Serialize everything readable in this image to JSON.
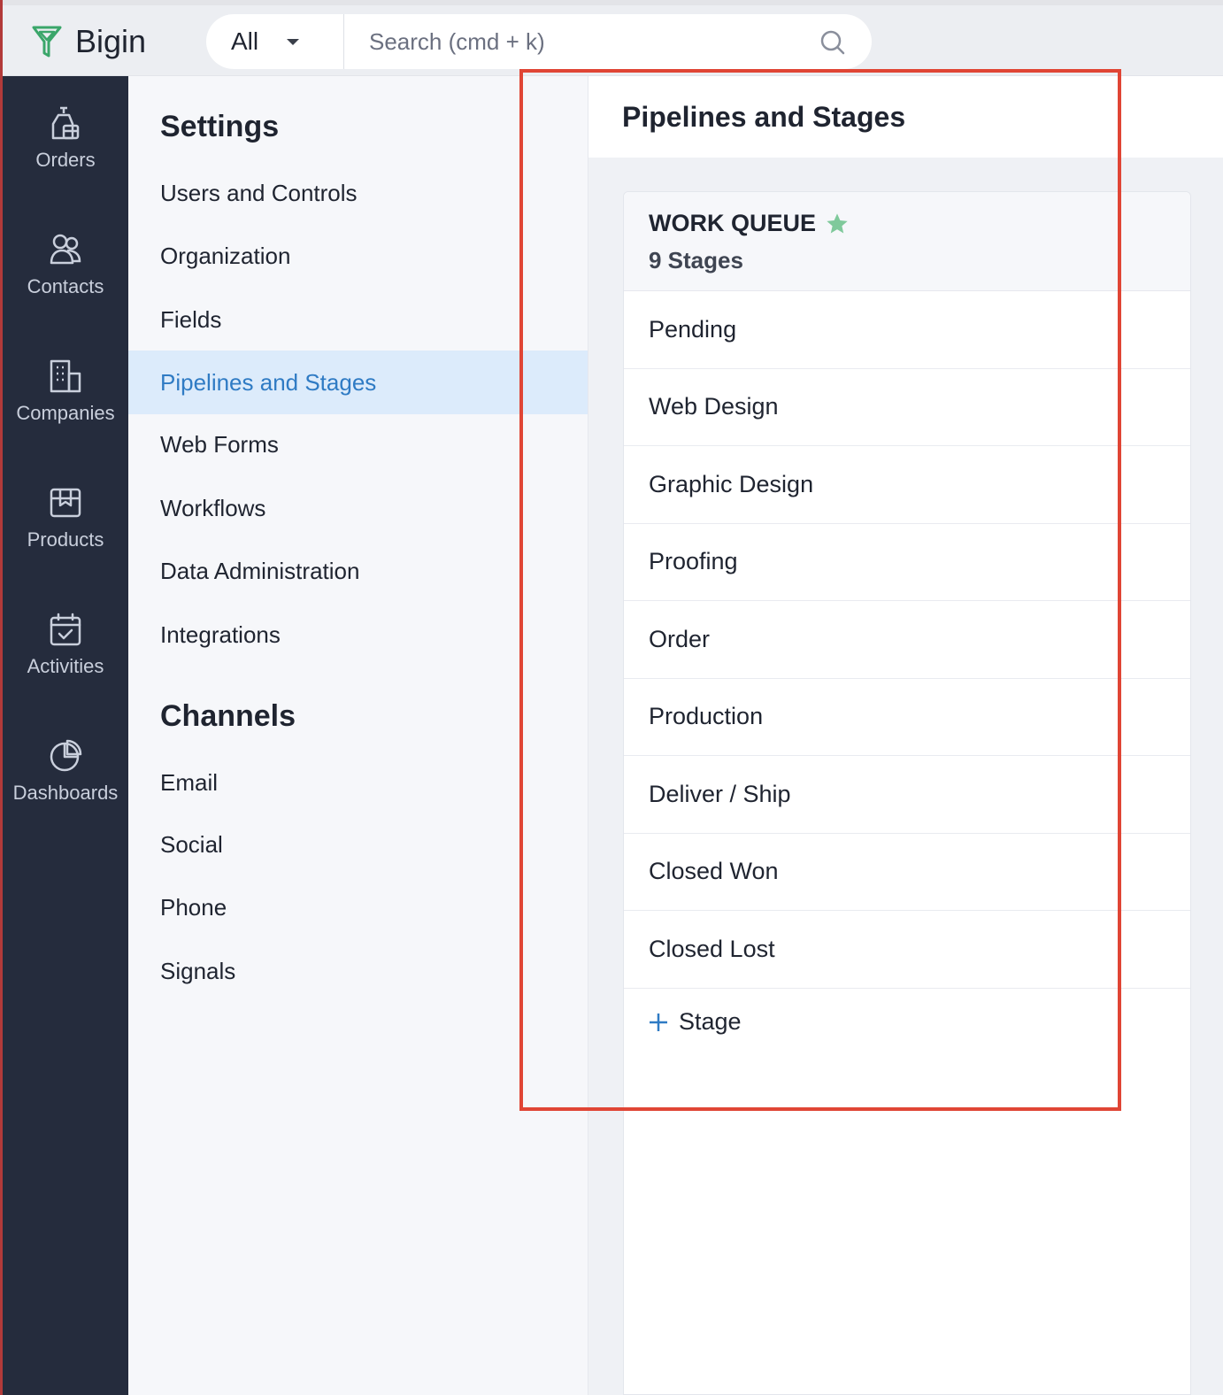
{
  "app": {
    "name": "Bigin"
  },
  "search": {
    "scope": "All",
    "placeholder": "Search (cmd + k)",
    "value": ""
  },
  "rail": {
    "items": [
      {
        "label": "Orders",
        "icon": "orders-icon"
      },
      {
        "label": "Contacts",
        "icon": "contacts-icon"
      },
      {
        "label": "Companies",
        "icon": "companies-icon"
      },
      {
        "label": "Products",
        "icon": "products-icon"
      },
      {
        "label": "Activities",
        "icon": "activities-icon"
      },
      {
        "label": "Dashboards",
        "icon": "dashboards-icon"
      }
    ]
  },
  "settings": {
    "heading": "Settings",
    "items": [
      "Users and Controls",
      "Organization",
      "Fields",
      "Pipelines and Stages",
      "Web Forms",
      "Workflows",
      "Data Administration",
      "Integrations"
    ],
    "active": "Pipelines and Stages"
  },
  "channels": {
    "heading": "Channels",
    "items": [
      "Email",
      "Social",
      "Phone",
      "Signals"
    ]
  },
  "content": {
    "title": "Pipelines and Stages",
    "pipeline": {
      "name": "WORK QUEUE",
      "stage_count": "9 Stages",
      "stages": [
        "Pending",
        "Web Design",
        "Graphic Design",
        "Proofing",
        "Order",
        "Production",
        "Deliver / Ship",
        "Closed Won",
        "Closed Lost"
      ],
      "add_stage_label": "Stage"
    }
  },
  "colors": {
    "rail_bg": "#252c3d",
    "active_nav_bg": "#dcebfb",
    "active_nav_text": "#2f7bc4",
    "star": "#7fc99b",
    "highlight": "#e04535",
    "plus": "#2f7bc4"
  }
}
